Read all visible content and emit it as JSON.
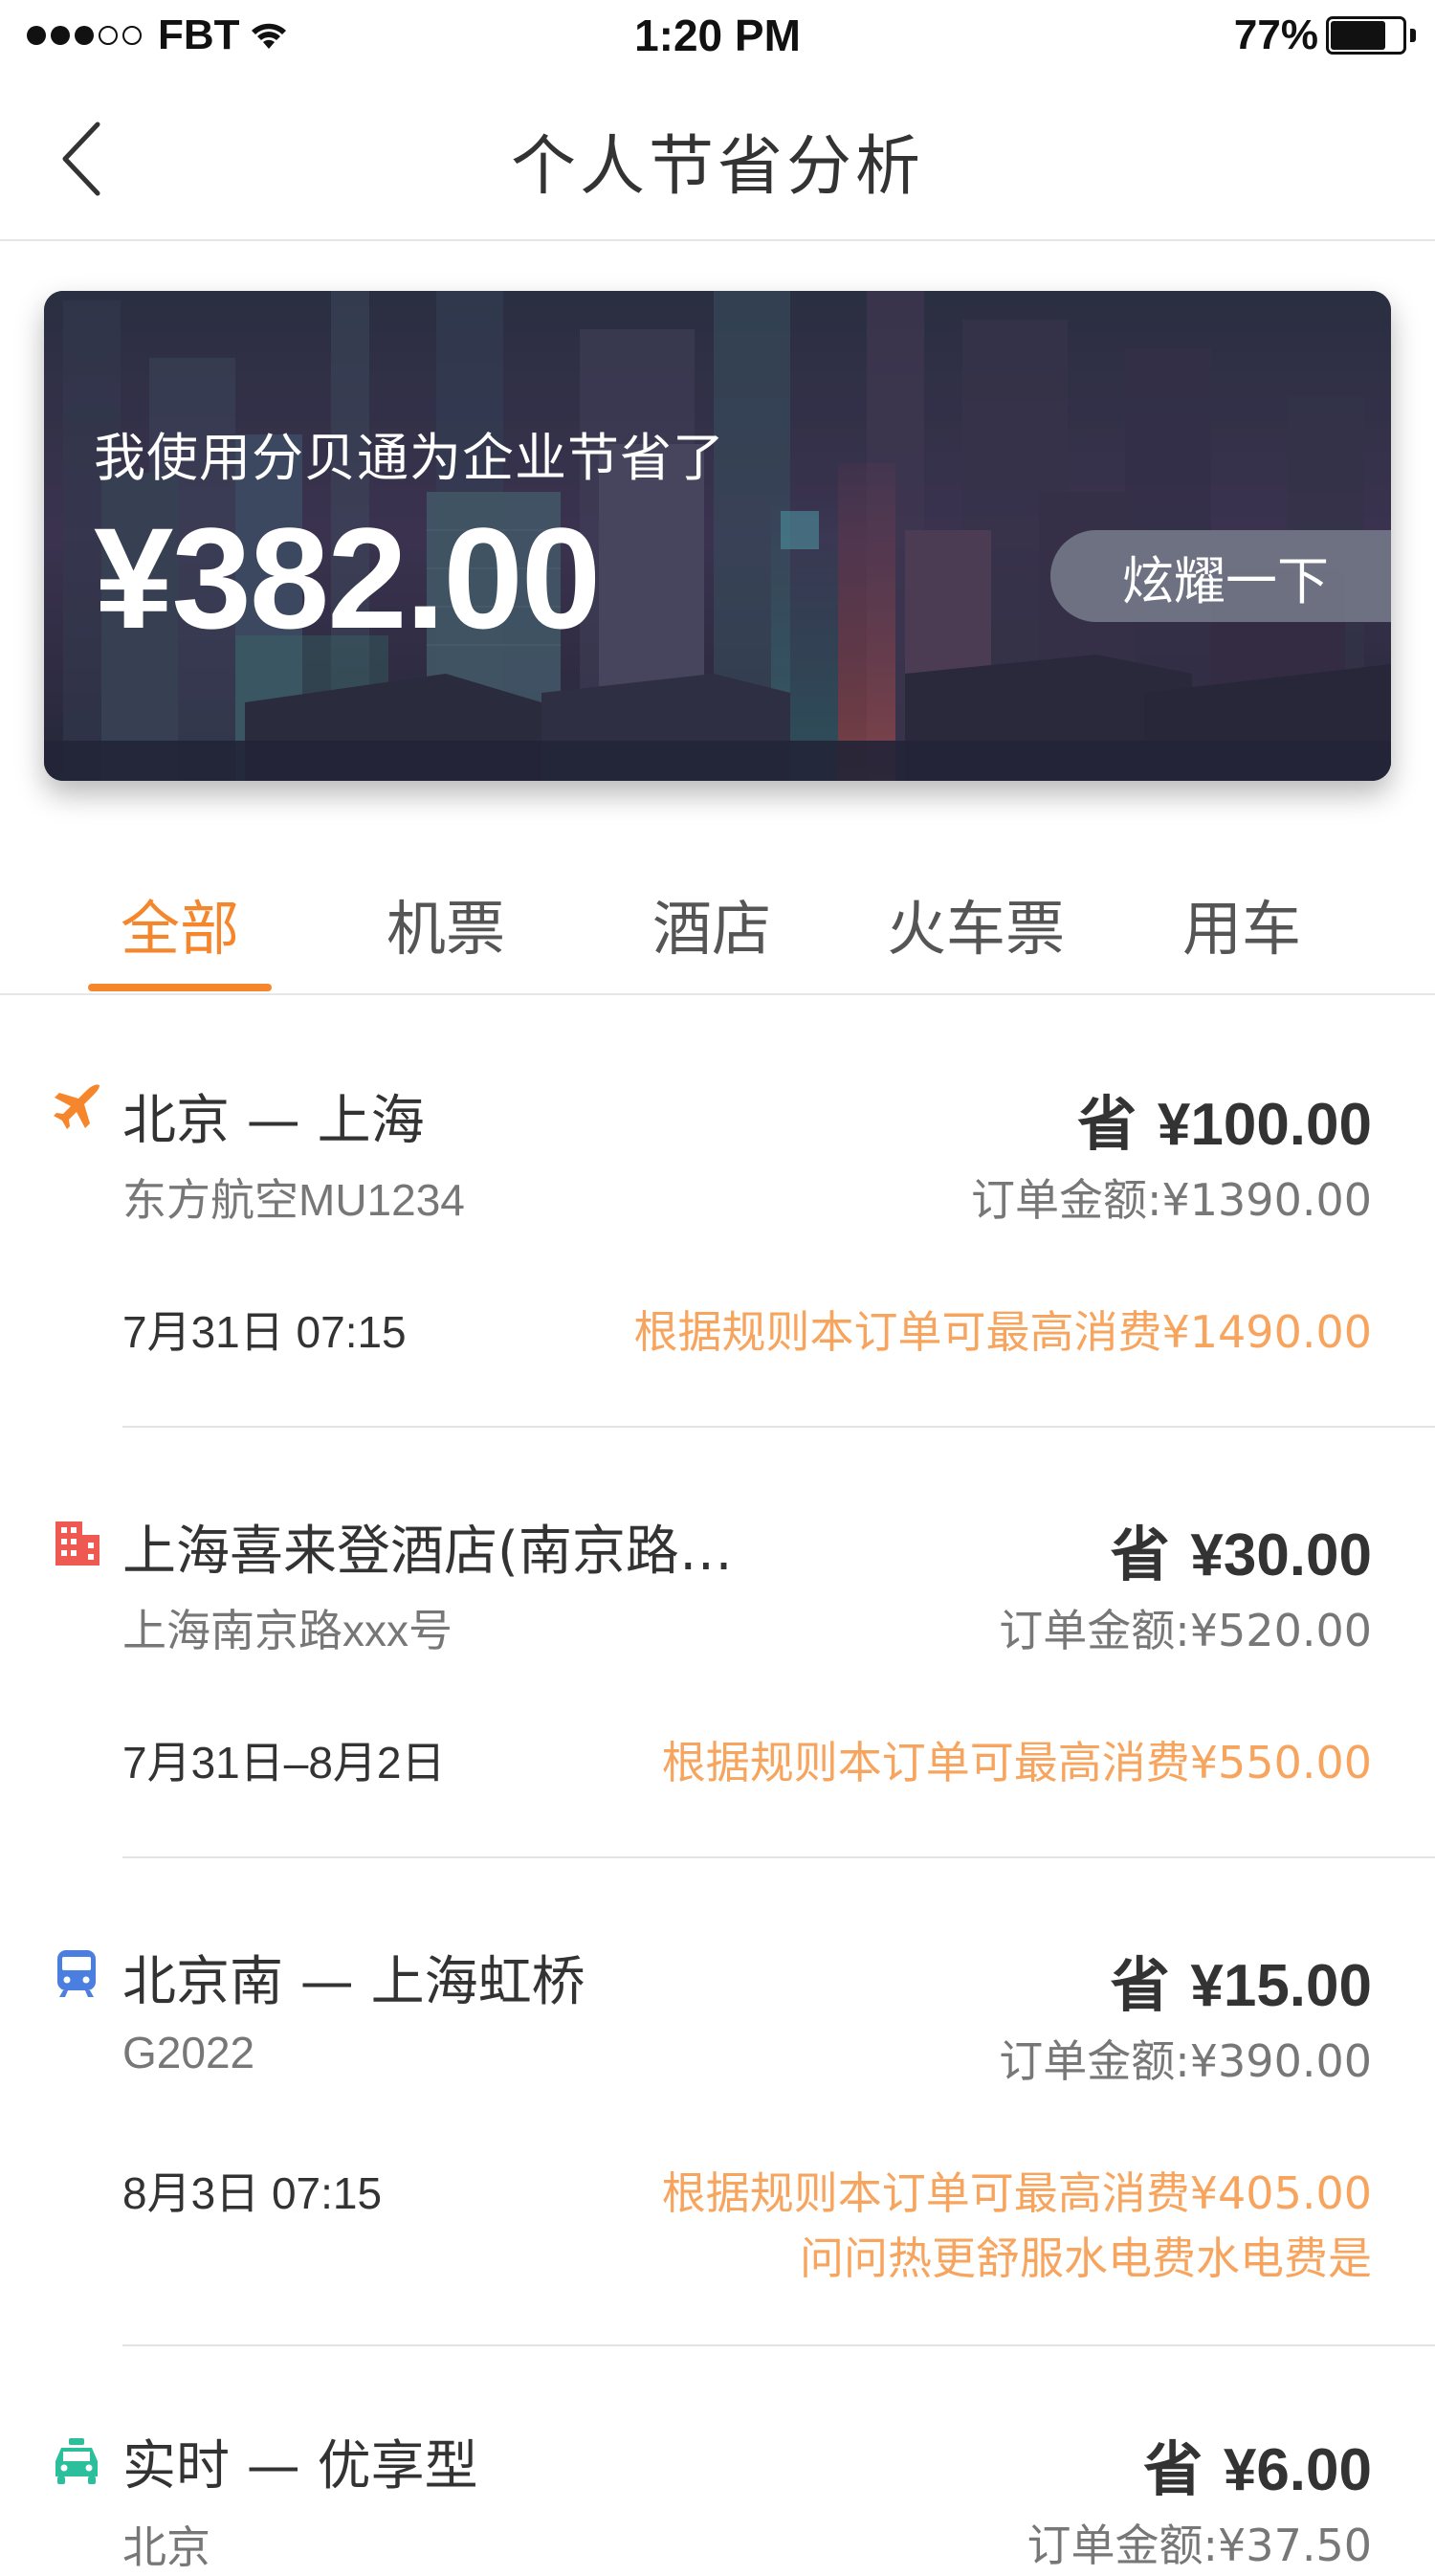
{
  "status_bar": {
    "carrier": "FBT",
    "time": "1:20 PM",
    "battery": "77%",
    "battery_level": 0.77,
    "signal_bars_filled": 3,
    "signal_bars_total": 5
  },
  "nav": {
    "title": "个人节省分析",
    "back_icon": "chevron-left-icon"
  },
  "banner": {
    "caption": "我使用分贝通为企业节省了",
    "amount": "¥382.00",
    "share_label": "炫耀一下"
  },
  "tabs": [
    {
      "label": "全部",
      "active": true
    },
    {
      "label": "机票",
      "active": false
    },
    {
      "label": "酒店",
      "active": false
    },
    {
      "label": "火车票",
      "active": false
    },
    {
      "label": "用车",
      "active": false
    }
  ],
  "orders": [
    {
      "icon": "plane-icon",
      "title": "北京 — 上海",
      "subtitle": "东方航空MU1234",
      "date": "7月31日 07:15",
      "saved_prefix": "省",
      "saved_amount": "¥100.00",
      "order_total": "订单金额:¥1390.00",
      "rule": "根据规则本订单可最高消费¥1490.00",
      "rule_extra": ""
    },
    {
      "icon": "hotel-icon",
      "title": "上海喜来登酒店(南京路…",
      "subtitle": "上海南京路xxx号",
      "date": "7月31日–8月2日",
      "saved_prefix": "省",
      "saved_amount": "¥30.00",
      "order_total": "订单金额:¥520.00",
      "rule": "根据规则本订单可最高消费¥550.00",
      "rule_extra": ""
    },
    {
      "icon": "train-icon",
      "title": "北京南 — 上海虹桥",
      "subtitle": "G2022",
      "date": "8月3日 07:15",
      "saved_prefix": "省",
      "saved_amount": "¥15.00",
      "order_total": "订单金额:¥390.00",
      "rule": "根据规则本订单可最高消费¥405.00",
      "rule_extra": "问问热更舒服水电费水电费是"
    },
    {
      "icon": "car-icon",
      "title": "实时 — 优享型",
      "subtitle": "北京",
      "date": "",
      "saved_prefix": "省",
      "saved_amount": "¥6.00",
      "order_total": "订单金额:¥37.50",
      "rule": "",
      "rule_extra": ""
    }
  ],
  "colors": {
    "accent": "#f5862c",
    "rule_text": "#f7a55e",
    "plane_icon": "#f5862c",
    "hotel_icon": "#ee5a52",
    "train_icon": "#4a7fe0",
    "car_icon": "#2bbf9b"
  }
}
